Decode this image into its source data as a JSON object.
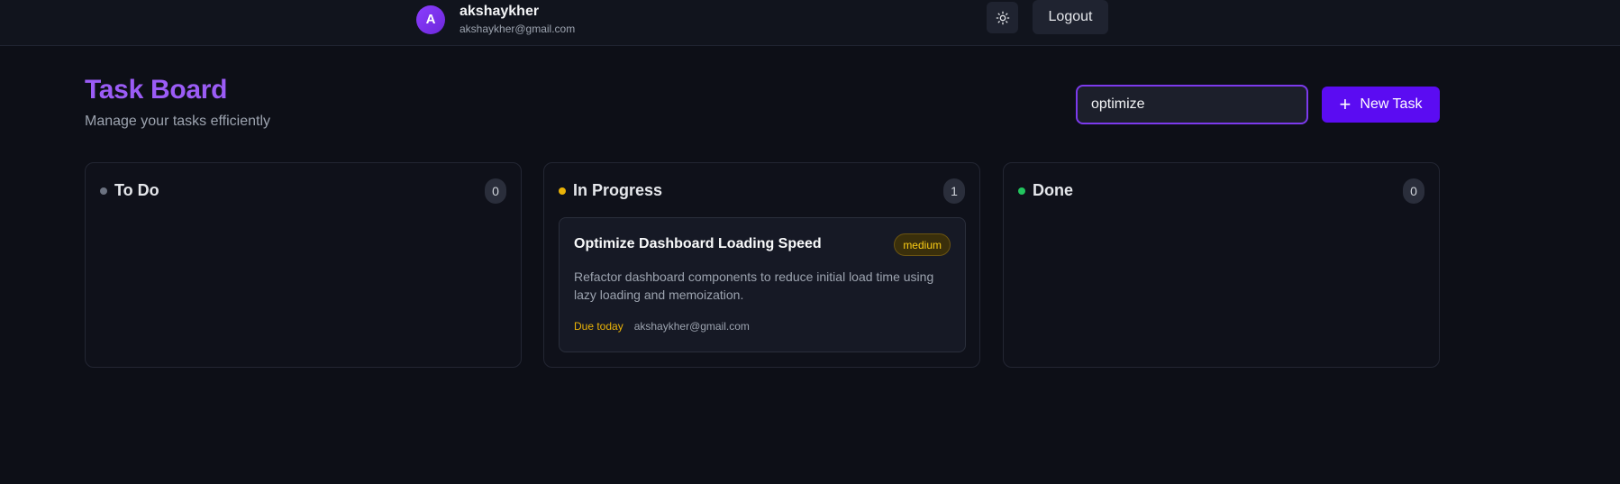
{
  "user": {
    "avatar_letter": "A",
    "name": "akshaykher",
    "email": "akshaykher@gmail.com"
  },
  "header": {
    "theme_icon": "sun-icon",
    "logout_label": "Logout"
  },
  "page": {
    "title": "Task Board",
    "subtitle": "Manage your tasks efficiently"
  },
  "search": {
    "value": "optimize",
    "placeholder": ""
  },
  "new_task": {
    "icon": "plus-icon",
    "label": "New Task"
  },
  "colors": {
    "accent": "#5b0cf2",
    "title": "#9b5cf6",
    "todo": "#6b7280",
    "in_progress": "#eab308",
    "done": "#22c55e"
  },
  "columns": [
    {
      "title": "To Do",
      "count": "0"
    },
    {
      "title": "In Progress",
      "count": "1",
      "cards": [
        {
          "title": "Optimize Dashboard Loading Speed",
          "priority": "medium",
          "description": "Refactor dashboard components to reduce initial load time using lazy loading and memoization.",
          "due": "Due today",
          "assignee": "akshaykher@gmail.com"
        }
      ]
    },
    {
      "title": "Done",
      "count": "0"
    }
  ]
}
